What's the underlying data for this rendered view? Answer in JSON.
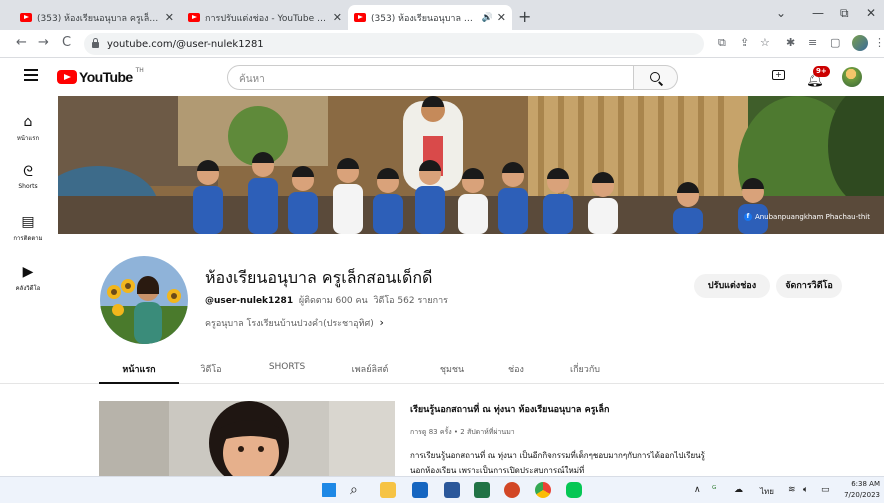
{
  "browser": {
    "tabs": [
      {
        "title": "(353) ห้องเรียนอนุบาล ครูเล็กสอนเด็กดี",
        "close": "✕"
      },
      {
        "title": "การปรับแต่งช่อง - YouTube Studio",
        "close": "✕"
      },
      {
        "title": "(353) ห้องเรียนอนุบาล ครูเล็กสอนเ",
        "audio": "🔊",
        "close": "✕"
      }
    ],
    "new_tab": "+",
    "window_controls": {
      "minimize": "—",
      "maximize": "⧉",
      "close": "✕",
      "dropdown": "⌄"
    },
    "url": "youtube.com/@user-nulek1281",
    "nav": {
      "back": "←",
      "forward": "→",
      "reload": "C"
    }
  },
  "youtube": {
    "logo_text": "YouTube",
    "region": "TH",
    "search_placeholder": "ค้นหา",
    "notification_count": "9+",
    "sidebar": [
      {
        "icon": "⌂",
        "label": "หน้าแรก"
      },
      {
        "icon": "ᘓ",
        "label": "Shorts"
      },
      {
        "icon": "▤",
        "label": "การติดตาม"
      },
      {
        "icon": "▶",
        "label": "คลังวิดีโอ"
      }
    ],
    "banner_credit": "Anubanpuangkham Phachau-thit",
    "channel": {
      "name": "ห้องเรียนอนุบาล ครูเล็กสอนเด็กดี",
      "handle": "@user-nulek1281",
      "subscribers": "ผู้ติดตาม 600 คน",
      "videos": "วิดีโอ 562 รายการ",
      "description": "ครูอนุบาล โรงเรียนบ้านปวงคำ(ประชาอุทิศ)",
      "desc_more": "›",
      "btn_customize": "ปรับแต่งช่อง",
      "btn_manage": "จัดการวิดีโอ"
    },
    "tabs": [
      "หน้าแรก",
      "วิดีโอ",
      "SHORTS",
      "เพลย์ลิสต์",
      "ชุมชน",
      "ช่อง",
      "เกี่ยวกับ"
    ],
    "featured": {
      "title": "เรียนรู้นอกสถานที่ ณ ทุ่งนา ห้องเรียนอนุบาล ครูเล็ก",
      "meta": "การดู 83 ครั้ง • 2 สัปดาห์ที่ผ่านมา",
      "description": "การเรียนรู้นอกสถานที่ ณ ทุ่งนา เป็นอีกกิจกรรมที่เด็กๆชอบมากๆกับการได้ออกไปเรียนรู้นอกห้องเรียน เพราะเป็นการเปิดประสบการณ์ใหม่ที่"
    }
  },
  "taskbar": {
    "lang": "ไทย",
    "time": "6:38 AM",
    "date": "7/20/2023",
    "tray_up": "∧"
  },
  "colors": {
    "brand_red": "#ff0000",
    "badge_red": "#cc0000",
    "link": "#065fd4"
  }
}
